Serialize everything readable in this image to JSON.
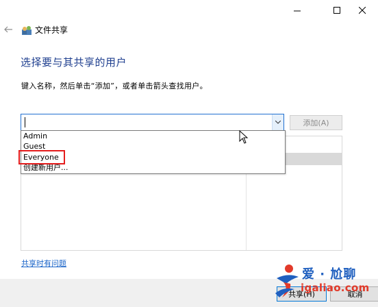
{
  "window": {
    "title": "文件共享"
  },
  "main": {
    "heading": "选择要与其共享的用户",
    "instruction": "键入名称，然后单击“添加”，或者单击箭头查找用户。",
    "input_value": "",
    "add_button_label": "添加(A)",
    "dropdown_options": [
      "Admin",
      "Guest",
      "Everyone",
      "创建新用户..."
    ],
    "highlighted_option": "Everyone",
    "help_link": "共享时有问题"
  },
  "footer": {
    "share_label": "共享(H)",
    "cancel_label": "取消"
  },
  "watermark": {
    "title": "爱 · 尬聊",
    "url": "igaliao.com"
  },
  "colors": {
    "heading": "#1f3f8f",
    "link": "#1a64c8",
    "input_border": "#1f6fd0",
    "highlight_box": "#e41c1c",
    "watermark_blue": "#1f5fbf",
    "watermark_red": "#e23a2a"
  },
  "icons": [
    "minimize-icon",
    "maximize-icon",
    "close-icon",
    "back-arrow-icon",
    "file-share-icon",
    "dropdown-arrow-icon",
    "mouse-cursor-icon",
    "watermark-logo-icon"
  ]
}
